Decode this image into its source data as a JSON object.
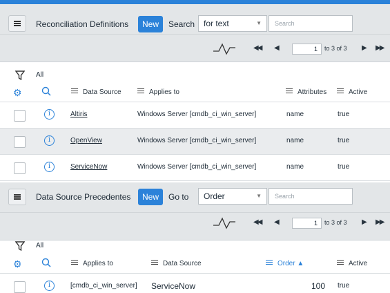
{
  "reconciliation": {
    "title": "Reconciliation Definitions",
    "new_label": "New",
    "search_label": "Search",
    "search_field": "for text",
    "search_placeholder": "Search",
    "pager": {
      "page": "1",
      "range": "to 3 of 3"
    },
    "filter": "All",
    "columns": [
      "Data Source",
      "Applies to",
      "Attributes",
      "Active"
    ],
    "rows": [
      {
        "data_source": "Altiris",
        "applies_to": "Windows Server [cmdb_ci_win_server]",
        "attributes": "name",
        "active": "true"
      },
      {
        "data_source": "OpenView",
        "applies_to": "Windows Server [cmdb_ci_win_server]",
        "attributes": "name",
        "active": "true"
      },
      {
        "data_source": "ServiceNow",
        "applies_to": "Windows Server [cmdb_ci_win_server]",
        "attributes": "name",
        "active": "true"
      }
    ]
  },
  "precedence": {
    "title": "Data Source Precedentes",
    "new_label": "New",
    "goto_label": "Go to",
    "goto_field": "Order",
    "search_placeholder": "Search",
    "pager": {
      "page": "1",
      "range": "to 3 of 3"
    },
    "filter": "All",
    "columns": [
      "Applies to",
      "Data Source",
      "Order ▲",
      "Active"
    ],
    "rows": [
      {
        "applies_to": "[cmdb_ci_win_server]",
        "data_source": "ServiceNow",
        "order": "100",
        "active": "true"
      }
    ]
  },
  "colors": {
    "accent": "#2b82d9",
    "header_bg": "#e3e6e8"
  },
  "icons": [
    "menu-icon",
    "pulse-icon",
    "first-page-icon",
    "prev-page-icon",
    "next-page-icon",
    "last-page-icon",
    "funnel-icon",
    "gear-icon",
    "search-icon",
    "info-icon"
  ]
}
